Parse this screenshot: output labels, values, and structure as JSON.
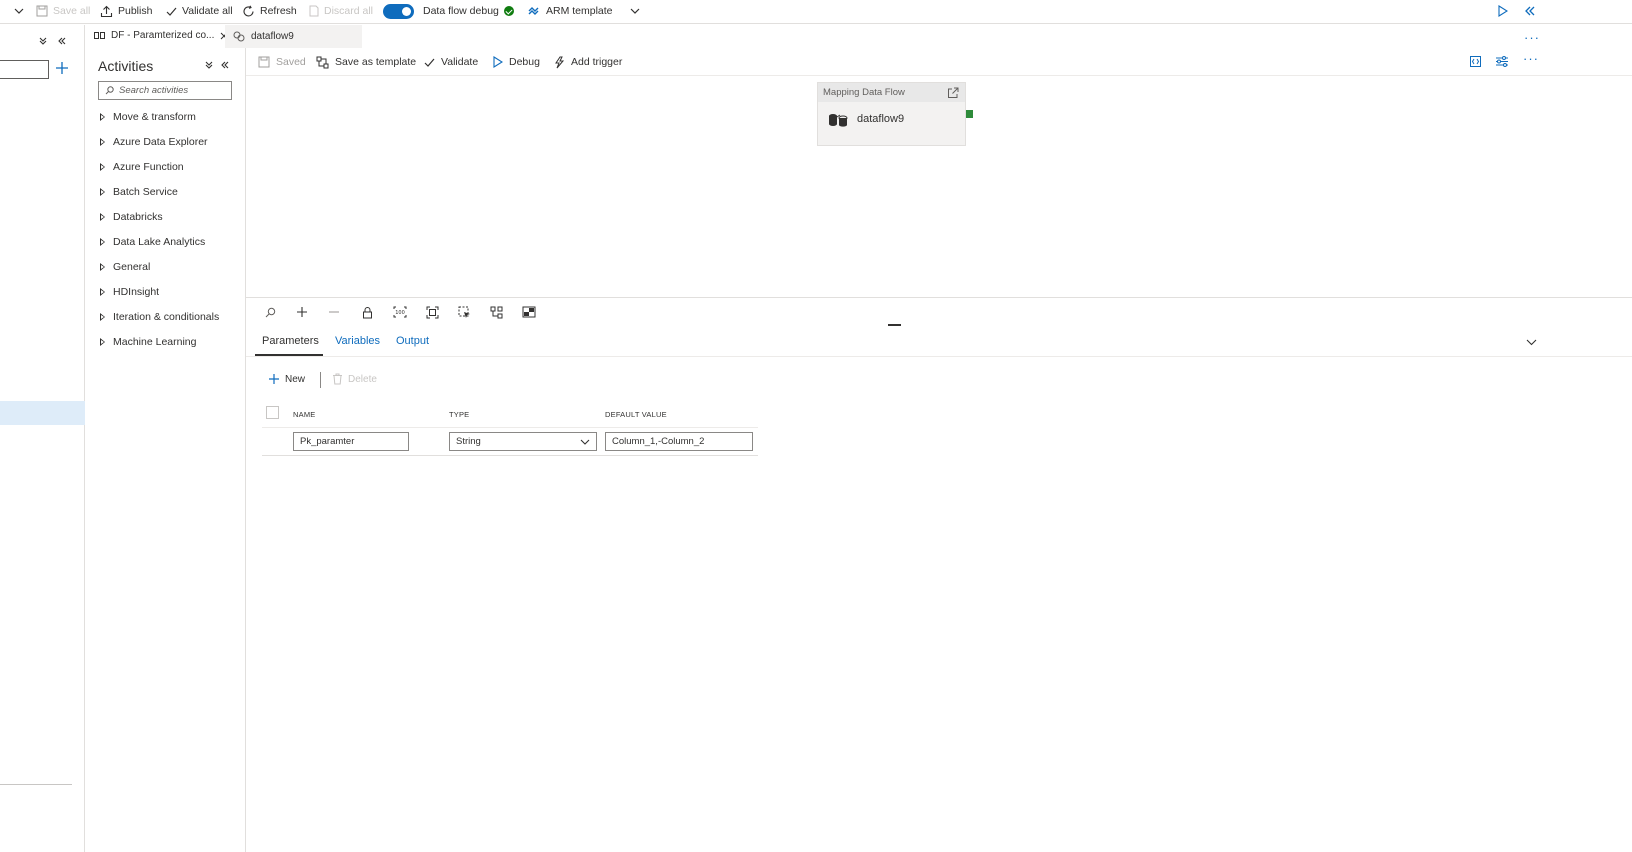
{
  "topbar": {
    "save_all": "Save all",
    "publish": "Publish",
    "validate_all": "Validate all",
    "refresh": "Refresh",
    "discard_all": "Discard all",
    "data_flow_debug": "Data flow debug",
    "data_flow_debug_on": true,
    "arm_template": "ARM template"
  },
  "tabs": [
    {
      "label": "DF - Paramterized co...",
      "icon": "pipeline-icon",
      "active": true
    },
    {
      "label": "dataflow9",
      "icon": "dataflow-icon",
      "active": false
    }
  ],
  "activities": {
    "title": "Activities",
    "search_placeholder": "Search activities",
    "groups": [
      "Move & transform",
      "Azure Data Explorer",
      "Azure Function",
      "Batch Service",
      "Databricks",
      "Data Lake Analytics",
      "General",
      "HDInsight",
      "Iteration & conditionals",
      "Machine Learning"
    ]
  },
  "canvas_toolbar": {
    "saved": "Saved",
    "save_as_template": "Save as template",
    "validate": "Validate",
    "debug": "Debug",
    "add_trigger": "Add trigger"
  },
  "node": {
    "type": "Mapping Data Flow",
    "name": "dataflow9"
  },
  "props": {
    "tabs": [
      "Parameters",
      "Variables",
      "Output"
    ],
    "active_tab": "Parameters",
    "new_label": "New",
    "delete_label": "Delete",
    "columns": {
      "name": "NAME",
      "type": "TYPE",
      "default": "DEFAULT VALUE"
    },
    "rows": [
      {
        "name": "Pk_paramter",
        "type": "String",
        "default": "Column_1,-Column_2"
      }
    ]
  },
  "colors": {
    "accent": "#0f6cbd",
    "success": "#107c10",
    "handle": "#2e8b3a"
  }
}
